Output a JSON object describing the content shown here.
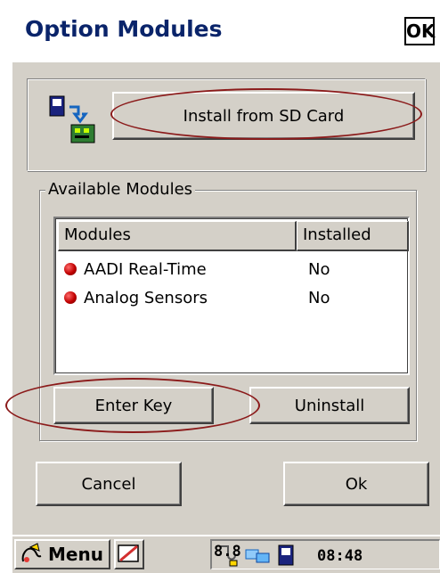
{
  "window": {
    "title": "Option Modules",
    "ok_label": "OK"
  },
  "install": {
    "button_label": "Install from SD Card",
    "icon": "sd-card-install-icon"
  },
  "modules": {
    "group_label": "Available Modules",
    "columns": [
      "Modules",
      "Installed"
    ],
    "rows": [
      {
        "name": "AADI Real-Time",
        "installed": "No",
        "status_icon": "red-dot-icon"
      },
      {
        "name": "Analog Sensors",
        "installed": "No",
        "status_icon": "red-dot-icon"
      }
    ],
    "enter_key_label": "Enter Key",
    "uninstall_label": "Uninstall"
  },
  "footer": {
    "cancel_label": "Cancel",
    "ok_label": "Ok"
  },
  "taskbar": {
    "menu_label": "Menu",
    "time": "08:48",
    "extra": "8.8",
    "icons": [
      "start-flag-icon",
      "keyboard-icon",
      "connection-icon",
      "network-icon",
      "sd-card-icon"
    ]
  },
  "colors": {
    "title_text": "#0a246a",
    "annotation_ellipse": "#8b1a1a",
    "status_dot": "#c00000",
    "window_bg": "#d4d0c8"
  }
}
